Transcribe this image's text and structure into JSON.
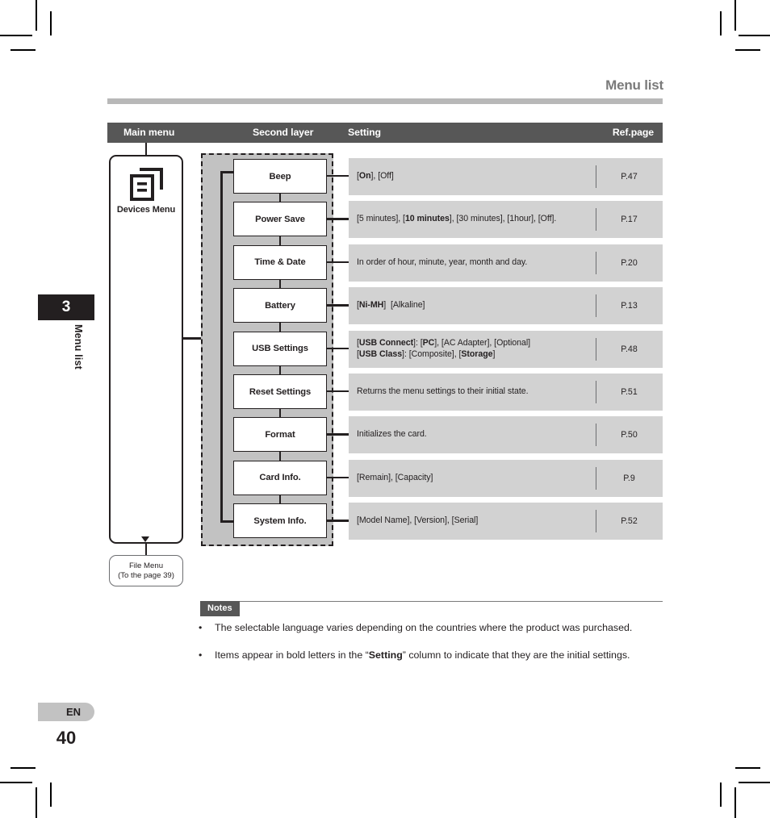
{
  "header": {
    "title": "Menu list"
  },
  "chapter": {
    "number": "3",
    "label": "Menu list"
  },
  "table": {
    "columns": {
      "main_menu": "Main menu",
      "second_layer": "Second layer",
      "setting": "Setting",
      "ref_page": "Ref.page"
    }
  },
  "main_menu": {
    "icon": "documents-stack-icon",
    "label": "Devices Menu"
  },
  "file_menu": {
    "title": "File Menu",
    "subtitle": "(To the page 39)"
  },
  "rows": [
    {
      "menu": "Beep",
      "setting_html": "[<b>On</b>], [Off]",
      "ref": "P.47"
    },
    {
      "menu": "Power Save",
      "setting_html": "[5 minutes], [<b>10 minutes</b>], [30 minutes], [1hour], [Off].",
      "ref": "P.17"
    },
    {
      "menu": "Time &amp; Date",
      "setting_html": "In order of hour, minute, year, month and day.",
      "ref": "P.20"
    },
    {
      "menu": "Battery",
      "setting_html": "[<b>Ni-MH</b>]&nbsp; [Alkaline]",
      "ref": "P.13"
    },
    {
      "menu": "USB Settings",
      "setting_html": "[<b>USB Connect</b>]: [<b>PC</b>], [AC Adapter], [Optional]<br>[<b>USB Class</b>]: [Composite], [<b>Storage</b>]",
      "ref": "P.48"
    },
    {
      "menu": "Reset Settings",
      "setting_html": "Returns the menu settings to their initial state.",
      "ref": "P.51"
    },
    {
      "menu": "Format",
      "setting_html": "Initializes the card.",
      "ref": "P.50"
    },
    {
      "menu": "Card Info.",
      "setting_html": "[Remain], [Capacity]",
      "ref": "P.9"
    },
    {
      "menu": "System Info.",
      "setting_html": "[Model Name], [Version], [Serial]",
      "ref": "P.52"
    }
  ],
  "notes": {
    "badge": "Notes",
    "items": [
      {
        "bullet": "•",
        "text_html": "The selectable language varies depending on the countries where the product was purchased."
      },
      {
        "bullet": "•",
        "text_html": "Items appear in bold letters in the “<b>Setting</b>” column to indicate that they are the initial settings."
      }
    ]
  },
  "footer": {
    "language": "EN",
    "page_number": "40"
  },
  "colors": {
    "header_bar": "#575757",
    "group_fill": "#c2c2c2",
    "row_fill": "#d2d2d2",
    "rule": "#b8b8b8",
    "ink": "#231f20"
  }
}
